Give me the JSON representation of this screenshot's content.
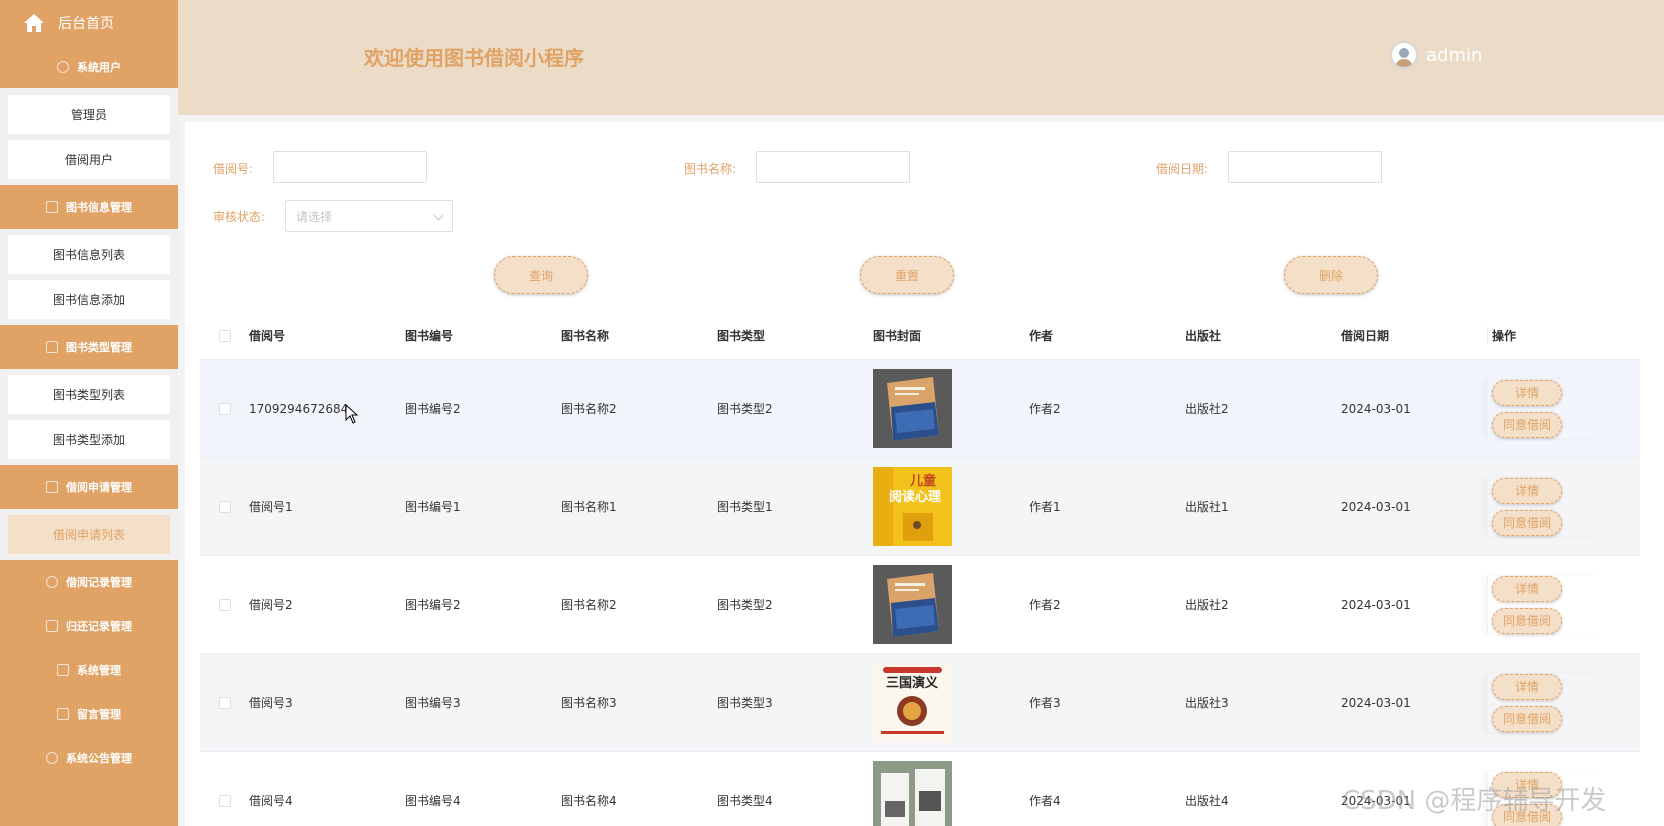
{
  "sidebar": {
    "home_label": "后台首页",
    "groups": [
      {
        "label": "系统用户",
        "items": [
          "管理员",
          "借阅用户"
        ]
      },
      {
        "label": "图书信息管理",
        "items": [
          "图书信息列表",
          "图书信息添加"
        ]
      },
      {
        "label": "图书类型管理",
        "items": [
          "图书类型列表",
          "图书类型添加"
        ]
      },
      {
        "label": "借阅申请管理",
        "items": [
          "借阅申请列表"
        ]
      },
      {
        "label": "借阅记录管理",
        "items": []
      },
      {
        "label": "归还记录管理",
        "items": []
      },
      {
        "label": "系统管理",
        "items": []
      },
      {
        "label": "留言管理",
        "items": []
      },
      {
        "label": "系统公告管理",
        "items": []
      }
    ],
    "active_item": "借阅申请列表"
  },
  "header": {
    "title": "欢迎使用图书借阅小程序",
    "username": "admin"
  },
  "search": {
    "borrow_no_label": "借阅号:",
    "book_name_label": "图书名称:",
    "borrow_date_label": "借阅日期:",
    "review_status_label": "审核状态:",
    "review_status_placeholder": "请选择",
    "query_button": "查询",
    "reset_button": "重置",
    "delete_button": "删除"
  },
  "table": {
    "columns": [
      "借阅号",
      "图书编号",
      "图书名称",
      "图书类型",
      "图书封面",
      "作者",
      "出版社",
      "借阅日期",
      "操作"
    ],
    "action_detail": "详情",
    "action_approve": "同意借阅",
    "rows": [
      {
        "borrow_no": "1709294672684",
        "book_no": "图书编号2",
        "book_name": "图书名称2",
        "book_type": "图书类型2",
        "cover": "cover-blue",
        "author": "作者2",
        "publisher": "出版社2",
        "date": "2024-03-01"
      },
      {
        "borrow_no": "借阅号1",
        "book_no": "图书编号1",
        "book_name": "图书名称1",
        "book_type": "图书类型1",
        "cover": "cover-yellow",
        "author": "作者1",
        "publisher": "出版社1",
        "date": "2024-03-01"
      },
      {
        "borrow_no": "借阅号2",
        "book_no": "图书编号2",
        "book_name": "图书名称2",
        "book_type": "图书类型2",
        "cover": "cover-blue",
        "author": "作者2",
        "publisher": "出版社2",
        "date": "2024-03-01"
      },
      {
        "borrow_no": "借阅号3",
        "book_no": "图书编号3",
        "book_name": "图书名称3",
        "book_type": "图书类型3",
        "cover": "cover-sanguo",
        "author": "作者3",
        "publisher": "出版社3",
        "date": "2024-03-01"
      },
      {
        "borrow_no": "借阅号4",
        "book_no": "图书编号4",
        "book_name": "图书名称4",
        "book_type": "图书类型4",
        "cover": "cover-grey",
        "author": "作者4",
        "publisher": "出版社4",
        "date": "2024-03-01"
      }
    ]
  },
  "cover_texts": {
    "yellow_title": "儿童阅读心理",
    "sanguo_title": "三国演义"
  },
  "watermark": "CSDN @程序辅导开发",
  "colors": {
    "accent": "#e0a265",
    "header_bg": "#ecdcc7",
    "button_bg": "#f4dfc9"
  }
}
